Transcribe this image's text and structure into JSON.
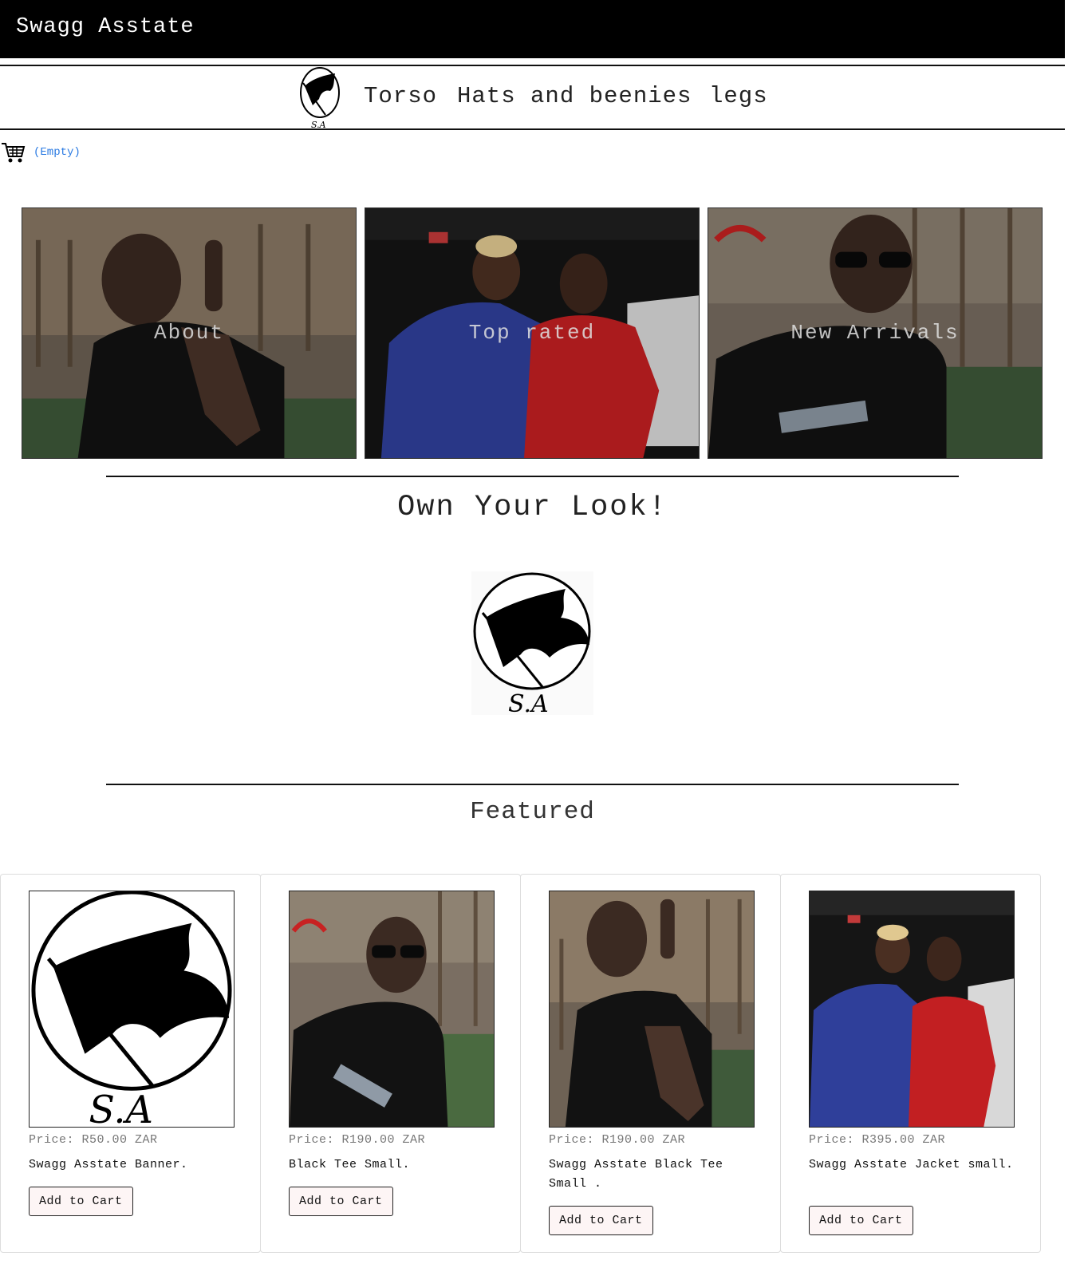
{
  "header": {
    "brand": "Swagg Asstate"
  },
  "nav": {
    "links": [
      "Torso",
      "Hats and beenies",
      "legs"
    ]
  },
  "cart": {
    "status": "(Empty)"
  },
  "tiles": [
    {
      "label": "About"
    },
    {
      "label": "Top rated"
    },
    {
      "label": "New Arrivals"
    }
  ],
  "slogan": "Own Your Look!",
  "logo": {
    "monogram": "S.A"
  },
  "featured": {
    "title": "Featured",
    "products": [
      {
        "price": "Price: R50.00 ZAR",
        "name": "Swagg Asstate Banner.",
        "button": "Add to Cart"
      },
      {
        "price": "Price: R190.00 ZAR",
        "name": "Black Tee Small.",
        "button": "Add to Cart"
      },
      {
        "price": "Price: R190.00 ZAR",
        "name": "Swagg Asstate Black Tee Small .",
        "button": "Add to Cart"
      },
      {
        "price": "Price: R395.00 ZAR",
        "name": "Swagg Asstate Jacket small.",
        "button": "Add to Cart"
      }
    ]
  },
  "colors": {
    "topbar": "#000000",
    "link": "#2a7ae2",
    "button_bg": "#fdf5f5"
  },
  "icons": [
    "logo-icon",
    "cart-icon"
  ]
}
